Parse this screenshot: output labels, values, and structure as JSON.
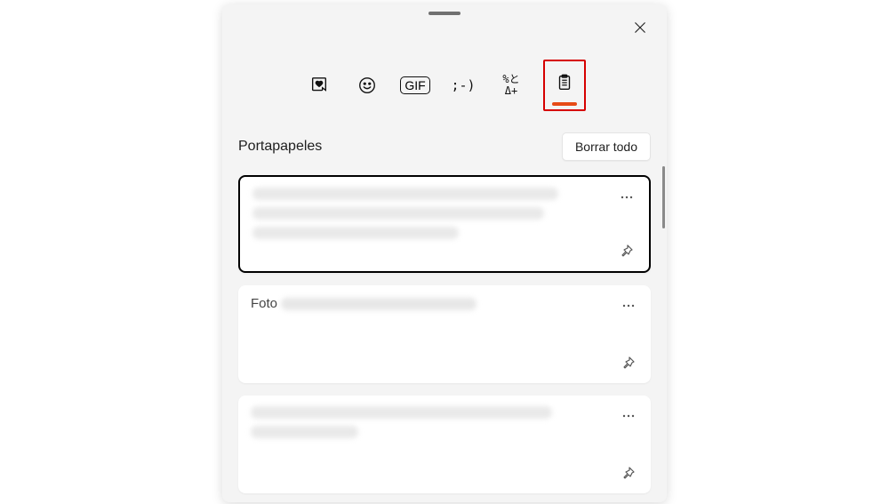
{
  "panel": {
    "section_title": "Portapapeles",
    "clear_all_label": "Borrar todo"
  },
  "tabs": {
    "recent": "recent",
    "emoji": "emoji",
    "gif_label": "GIF",
    "kaomoji_glyph": ";-)",
    "symbols_glyph": "%と\nΔ+",
    "clipboard": "clipboard",
    "active": "clipboard"
  },
  "items": [
    {
      "selected": true,
      "visible_text": "",
      "lines": 3
    },
    {
      "selected": false,
      "visible_text": "Foto",
      "lines": 1
    },
    {
      "selected": false,
      "visible_text": "",
      "lines": 2
    }
  ]
}
